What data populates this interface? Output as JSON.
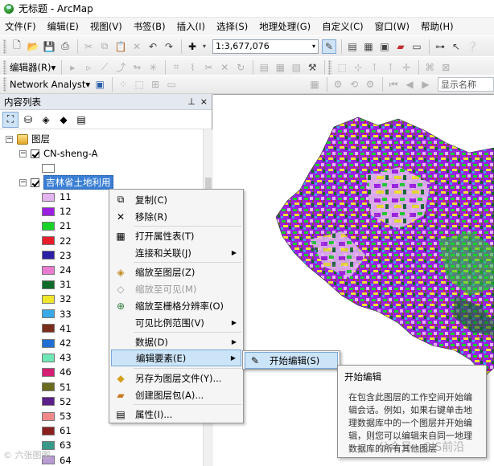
{
  "window": {
    "title": "无标题 - ArcMap"
  },
  "menu": [
    "文件(F)",
    "编辑(E)",
    "视图(V)",
    "书签(B)",
    "插入(I)",
    "选择(S)",
    "地理处理(G)",
    "自定义(C)",
    "窗口(W)",
    "帮助(H)"
  ],
  "toolbar": {
    "scale_value": "1:3,677,076"
  },
  "editor_toolbar": {
    "label": "编辑器(R)▾"
  },
  "network_toolbar": {
    "label": "Network Analyst▾",
    "name_placeholder": "显示名称"
  },
  "toc": {
    "title": "内容列表",
    "pin": "ꟷ",
    "close": "×",
    "root": "图层",
    "layer1": "CN-sheng-A",
    "layer2": "吉林省土地利用",
    "legend": [
      {
        "label": "11",
        "color": "#e3b4f0"
      },
      {
        "label": "12",
        "color": "#9b1fe0"
      },
      {
        "label": "21",
        "color": "#19d428"
      },
      {
        "label": "22",
        "color": "#e81f2b"
      },
      {
        "label": "23",
        "color": "#2b1fa6"
      },
      {
        "label": "24",
        "color": "#e97bd0"
      },
      {
        "label": "31",
        "color": "#0e6b2a"
      },
      {
        "label": "32",
        "color": "#f0e62a"
      },
      {
        "label": "33",
        "color": "#38a9e6"
      },
      {
        "label": "41",
        "color": "#7a2d1a"
      },
      {
        "label": "42",
        "color": "#1f6fd4"
      },
      {
        "label": "43",
        "color": "#6fe8b5"
      },
      {
        "label": "46",
        "color": "#d41f72"
      },
      {
        "label": "51",
        "color": "#6b6b1f"
      },
      {
        "label": "52",
        "color": "#5a1f8a"
      },
      {
        "label": "53",
        "color": "#f08a8a"
      },
      {
        "label": "61",
        "color": "#8a1f1f"
      },
      {
        "label": "63",
        "color": "#3a9a8a"
      },
      {
        "label": "64",
        "color": "#b89ad4"
      }
    ]
  },
  "context_menu": {
    "copy": "复制(C)",
    "remove": "移除(R)",
    "open_table": "打开属性表(T)",
    "joins": "连接和关联(J)",
    "zoom_layer": "缩放至图层(Z)",
    "zoom_visible": "缩放至可见(M)",
    "zoom_raster": "缩放至栅格分辨率(O)",
    "scale_range": "可见比例范围(V)",
    "data": "数据(D)",
    "edit_features": "编辑要素(E)",
    "save_layer": "另存为图层文件(Y)...",
    "create_package": "创建图层包(A)...",
    "properties": "属性(I)..."
  },
  "submenu": {
    "start_editing": "开始编辑(S)"
  },
  "tooltip": {
    "title": "开始编辑",
    "body": "在包含此图层的工作空间开始编辑会话。例如，如果右键单击地理数据库中的一个图层并开始编辑，则您可以编辑来自同一地理数据库的所有其他图层"
  },
  "watermarks": {
    "left": "© 六张图图",
    "right": "公众号 · GIS前沿"
  }
}
